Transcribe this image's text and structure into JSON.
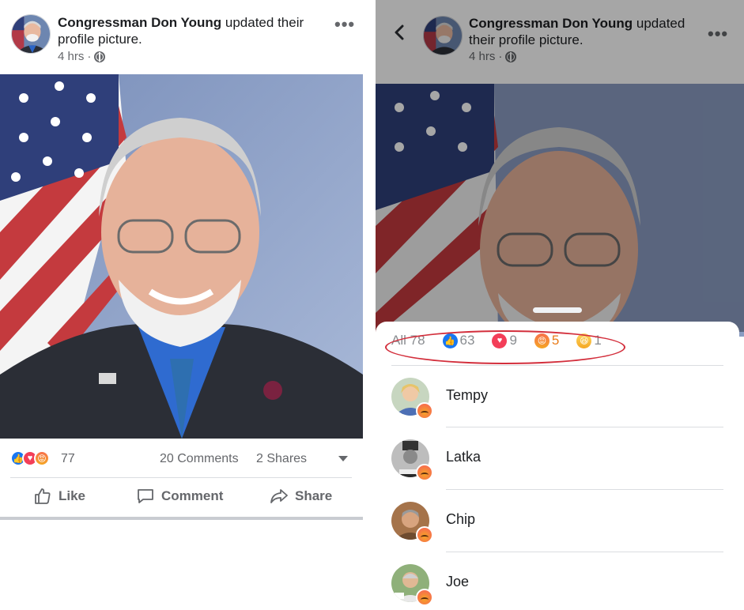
{
  "left": {
    "post_author": "Congressman Don Young",
    "post_action": " updated their",
    "post_action_line2": "profile picture.",
    "post_time": "4 hrs",
    "post_time_sep": " ·",
    "reaction_count": "77",
    "comments": "20 Comments",
    "shares": "2 Shares",
    "actions": {
      "like": "Like",
      "comment": "Comment",
      "share": "Share"
    },
    "more_glyph": "•••"
  },
  "right": {
    "post_author": "Congressman Don Young",
    "post_action": " updated",
    "post_action_line2": "their profile picture.",
    "post_time": "4 hrs",
    "post_time_sep": " ·",
    "more_glyph": "•••",
    "tabs": [
      {
        "label": "All 78",
        "icon": ""
      },
      {
        "label": "63",
        "icon": "like-icon"
      },
      {
        "label": "9",
        "icon": "love-icon"
      },
      {
        "label": "5",
        "icon": "angry-icon"
      },
      {
        "label": "1",
        "icon": "haha-icon"
      }
    ],
    "people": [
      {
        "name": "Tempy",
        "reaction": "angry"
      },
      {
        "name": "Latka",
        "reaction": "angry"
      },
      {
        "name": "Chip",
        "reaction": "angry"
      },
      {
        "name": "Joe",
        "reaction": "angry"
      }
    ]
  },
  "colors": {
    "facebook_blue": "#1877f2",
    "love_red": "#f33e58",
    "angry_orange": "#e97b18",
    "highlight_red": "#d32f3c",
    "secondary_text": "#65676b"
  }
}
